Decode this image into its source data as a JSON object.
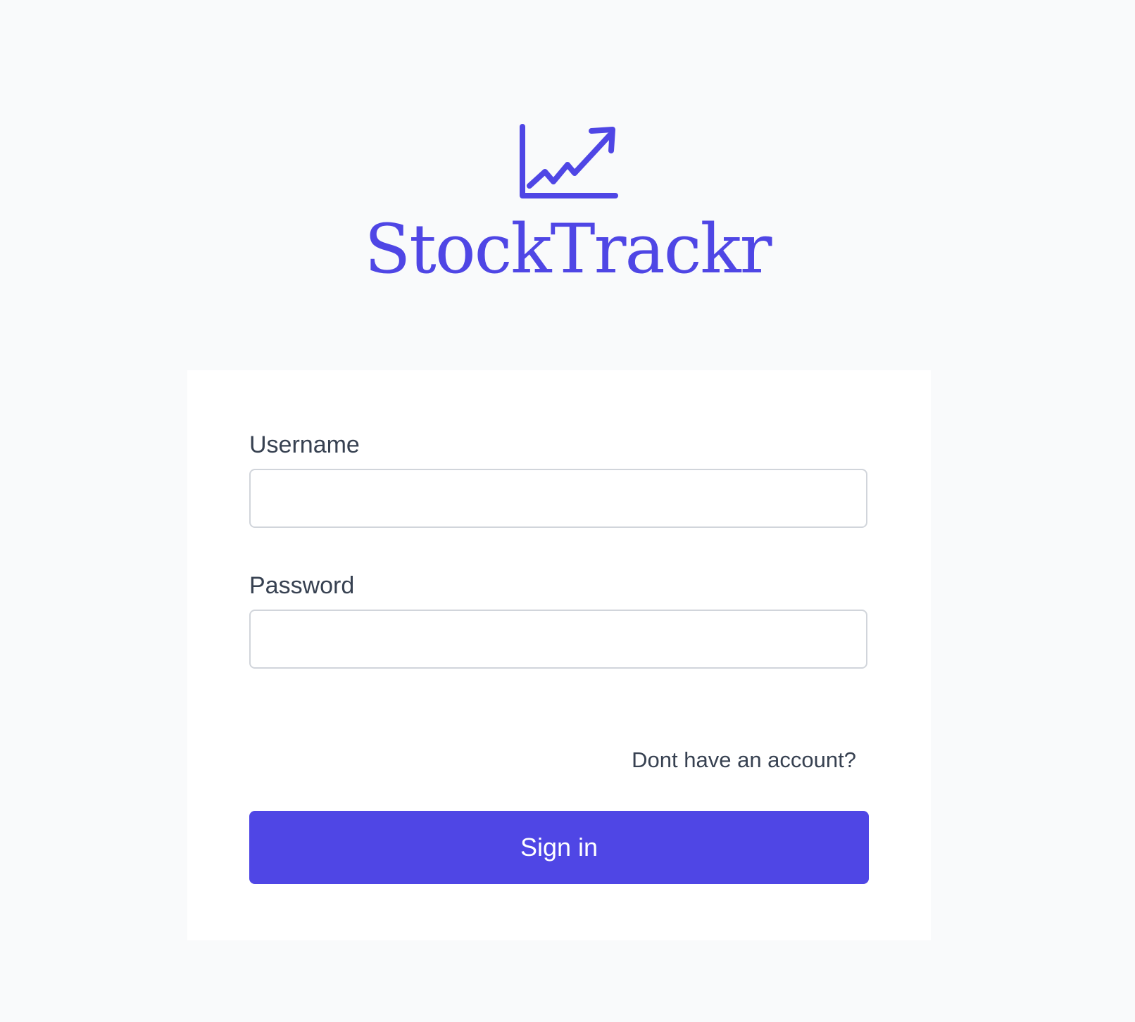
{
  "brand": {
    "name": "StockTrackr",
    "icon": "chart-trending-up-icon",
    "color": "#4f46e5"
  },
  "form": {
    "username_label": "Username",
    "username_value": "",
    "password_label": "Password",
    "password_value": "",
    "signup_link": "Dont have an account?",
    "submit_label": "Sign in"
  },
  "colors": {
    "background": "#f9fafb",
    "card": "#ffffff",
    "accent": "#4f46e5",
    "text": "#374151",
    "input_border": "#d1d5db"
  }
}
